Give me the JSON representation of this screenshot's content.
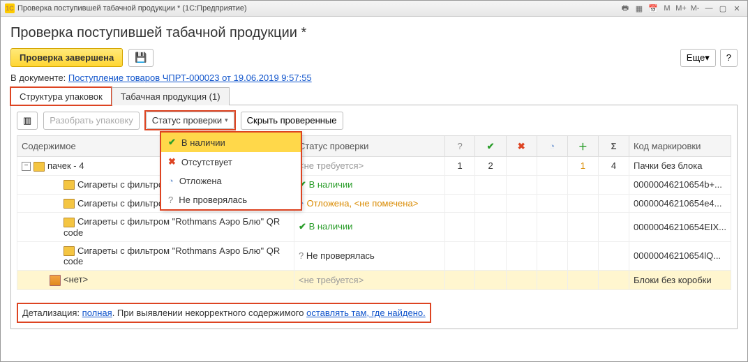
{
  "window": {
    "title": "Проверка поступившей табачной продукции *  (1С:Предприятие)"
  },
  "page": {
    "title": "Проверка поступившей табачной продукции *"
  },
  "toolbar": {
    "complete": "Проверка завершена",
    "more": "Еще",
    "help": "?"
  },
  "doc": {
    "label": "В документе:",
    "link": "Поступление товаров ЧПРТ-000023 от 19.06.2019 9:57:55"
  },
  "tabs": {
    "t1": "Структура упаковок",
    "t2": "Табачная продукция (1)"
  },
  "sub": {
    "unpack": "Разобрать упаковку",
    "status": "Статус проверки",
    "hide": "Скрыть проверенные"
  },
  "dd": {
    "in_stock": "В наличии",
    "absent": "Отсутствует",
    "postponed": "Отложена",
    "not_checked": "Не проверялась"
  },
  "grid": {
    "h_content": "Содержимое",
    "h_status": "Статус проверки",
    "h_q": "?",
    "h_mark": "Код маркировки",
    "rows": [
      {
        "name": "пачек -  4",
        "status": "<не требуется>",
        "q": "1",
        "ok": "2",
        "miss": "",
        "clk": "",
        "plus": "1",
        "sum": "4",
        "mark": "Пачки без блока"
      },
      {
        "name": "Сигареты с фильтром",
        "status": "В наличии",
        "mark": "00000046210654b+..."
      },
      {
        "name": "Сигареты с фильтром",
        "status": "Отложена, <не помечена>",
        "mark": "00000046210654e4..."
      },
      {
        "name": "Сигареты с фильтром \"Rothmans Аэро Блю\" QR code",
        "status": "В наличии",
        "mark": "00000046210654EIX..."
      },
      {
        "name": "Сигареты с фильтром \"Rothmans Аэро Блю\" QR code",
        "status": "Не проверялась",
        "mark": "00000046210654lQ..."
      },
      {
        "name": "<нет>",
        "status": "<не требуется>",
        "mark": "Блоки без коробки"
      }
    ]
  },
  "footer": {
    "prefix": "Детализация: ",
    "link1": "полная",
    "mid": ". При выявлении некорректного содержимого ",
    "link2": "оставлять там, где найдено."
  }
}
